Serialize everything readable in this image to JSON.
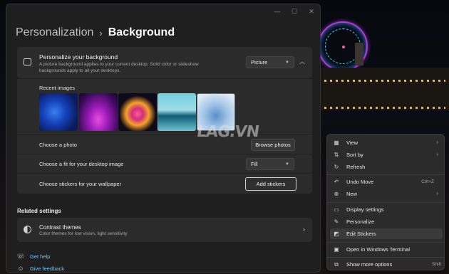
{
  "window": {
    "controls": {
      "minimize": "—",
      "maximize": "☐",
      "close": "✕"
    },
    "breadcrumb_parent": "Personalization",
    "breadcrumb_sep": "›",
    "breadcrumb_current": "Background"
  },
  "background_card": {
    "title": "Personalize your background",
    "description": "A picture background applies to your current desktop. Solid color or slideshow backgrounds apply to all your desktops.",
    "type_value": "Picture",
    "collapse_glyph": "︿"
  },
  "recent": {
    "label": "Recent images"
  },
  "rows": {
    "choose_photo": {
      "label": "Choose a photo",
      "button": "Browse photos"
    },
    "choose_fit": {
      "label": "Choose a fit for your desktop image",
      "value": "Fill"
    },
    "stickers": {
      "label": "Choose stickers for your wallpaper",
      "button": "Add stickers"
    }
  },
  "related": {
    "title": "Related settings",
    "contrast_title": "Contrast themes",
    "contrast_desc": "Color themes for low vision, light sensitivity"
  },
  "links": {
    "help": "Get help",
    "feedback": "Give feedback"
  },
  "watermark": "LAG.VN",
  "context_menu": {
    "items": [
      {
        "label": "View",
        "icon": "grid-icon",
        "submenu": true
      },
      {
        "label": "Sort by",
        "icon": "sort-icon",
        "submenu": true
      },
      {
        "label": "Refresh",
        "icon": "refresh-icon"
      },
      {
        "label": "Undo Move",
        "icon": "undo-icon",
        "shortcut": "Ctrl+Z"
      },
      {
        "label": "New",
        "icon": "plus-circle-icon",
        "submenu": true
      },
      {
        "label": "Display settings",
        "icon": "display-icon"
      },
      {
        "label": "Personalize",
        "icon": "brush-icon"
      },
      {
        "label": "Edit Stickers",
        "icon": "sticker-icon"
      },
      {
        "label": "Open in Windows Terminal",
        "icon": "terminal-icon"
      },
      {
        "label": "Show more options",
        "icon": "more-icon",
        "shortcut": "Shift"
      }
    ]
  },
  "colors": {
    "accent_link": "#6cc6ff",
    "window_bg": "#1f1f1f",
    "card_bg": "#2b2b2b"
  }
}
